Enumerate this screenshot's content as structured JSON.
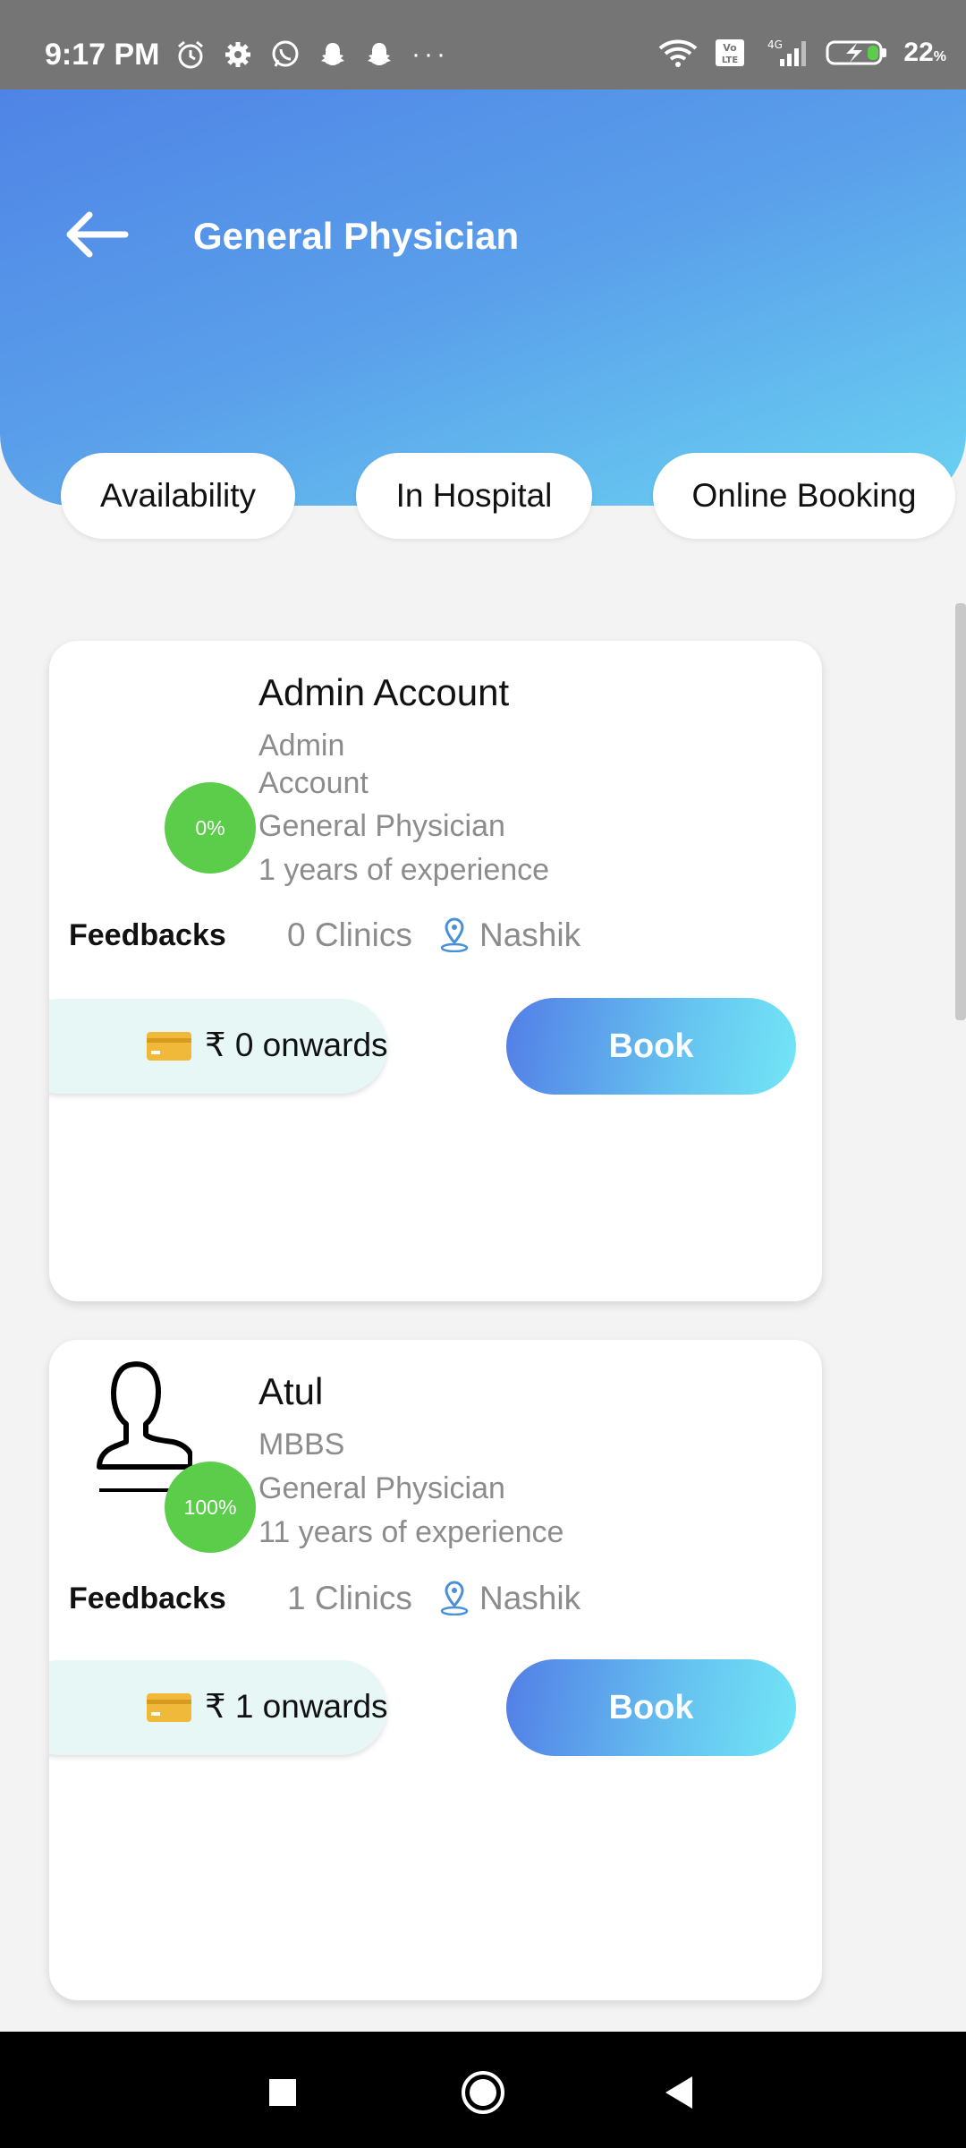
{
  "status_bar": {
    "time": "9:17 PM",
    "battery_percent": "22",
    "battery_unit": "%",
    "icons_left": [
      "alarm-icon",
      "gear-icon",
      "whatsapp-icon",
      "snapchat-icon",
      "snapchat-icon",
      "more-dots-icon"
    ],
    "icons_right": [
      "wifi-icon",
      "volte-icon",
      "signal-4g-icon",
      "battery-charging-icon"
    ],
    "dots": "···"
  },
  "header": {
    "title": "General Physician",
    "back_icon": "arrow-left-icon"
  },
  "filters": [
    "Availability",
    "In Hospital",
    "Online Booking"
  ],
  "doctors": [
    {
      "name": "Admin Account",
      "qualification_line1": "Admin",
      "qualification_line2": "Account",
      "specialty": "General Physician",
      "experience": "1 years of experience",
      "rating": "0%",
      "feedbacks_label": "Feedbacks",
      "clinics": "0 Clinics",
      "location": "Nashik",
      "price": "₹ 0 onwards",
      "book_label": "Book"
    },
    {
      "name": "Atul",
      "qualification": "MBBS",
      "specialty": "General Physician",
      "experience": "11 years of experience",
      "rating": "100%",
      "feedbacks_label": "Feedbacks",
      "clinics": "1 Clinics",
      "location": "Nashik",
      "price": "₹ 1 onwards",
      "book_label": "Book"
    }
  ],
  "colors": {
    "header_gradient_start": "#4f84e6",
    "header_gradient_end": "#6bd3f2",
    "rating_green": "#5ccd4b",
    "price_bg": "#e7f7f6",
    "card_icon": "#f0b93a"
  },
  "nav_bar": [
    "recents-square-icon",
    "home-circle-icon",
    "back-triangle-icon"
  ]
}
